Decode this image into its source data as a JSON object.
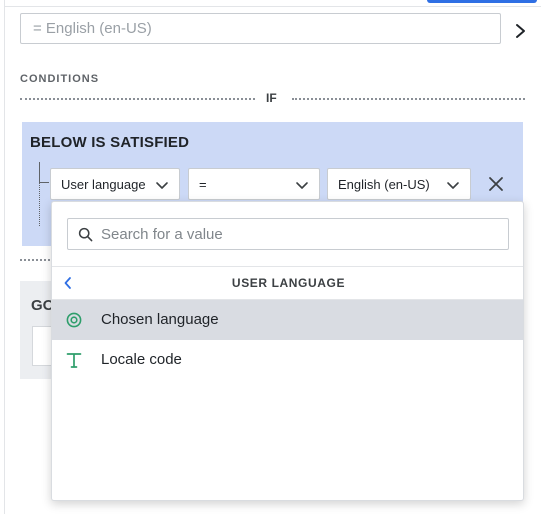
{
  "value_field": {
    "text": "= English (en-US)"
  },
  "conditions": {
    "section_label": "CONDITIONS",
    "if_label": "IF"
  },
  "block": {
    "title": "BELOW IS SATISFIED",
    "attribute_select": "User language",
    "operator_select": "=",
    "value_select": "English (en-US)",
    "go_label": "GO"
  },
  "dropdown": {
    "search_placeholder": "Search for a value",
    "header_title": "USER LANGUAGE",
    "items": [
      {
        "label": "Chosen language",
        "icon": "target-icon",
        "selected": true
      },
      {
        "label": "Locale code",
        "icon": "text-type-icon",
        "selected": false
      }
    ]
  },
  "colors": {
    "accent": "#2f6fe4",
    "condition_block_bg": "#ccd9f6",
    "icon_green": "#2e9e6b",
    "back_chevron_blue": "#2f6fe4",
    "selected_row_bg": "#d9dce2"
  }
}
